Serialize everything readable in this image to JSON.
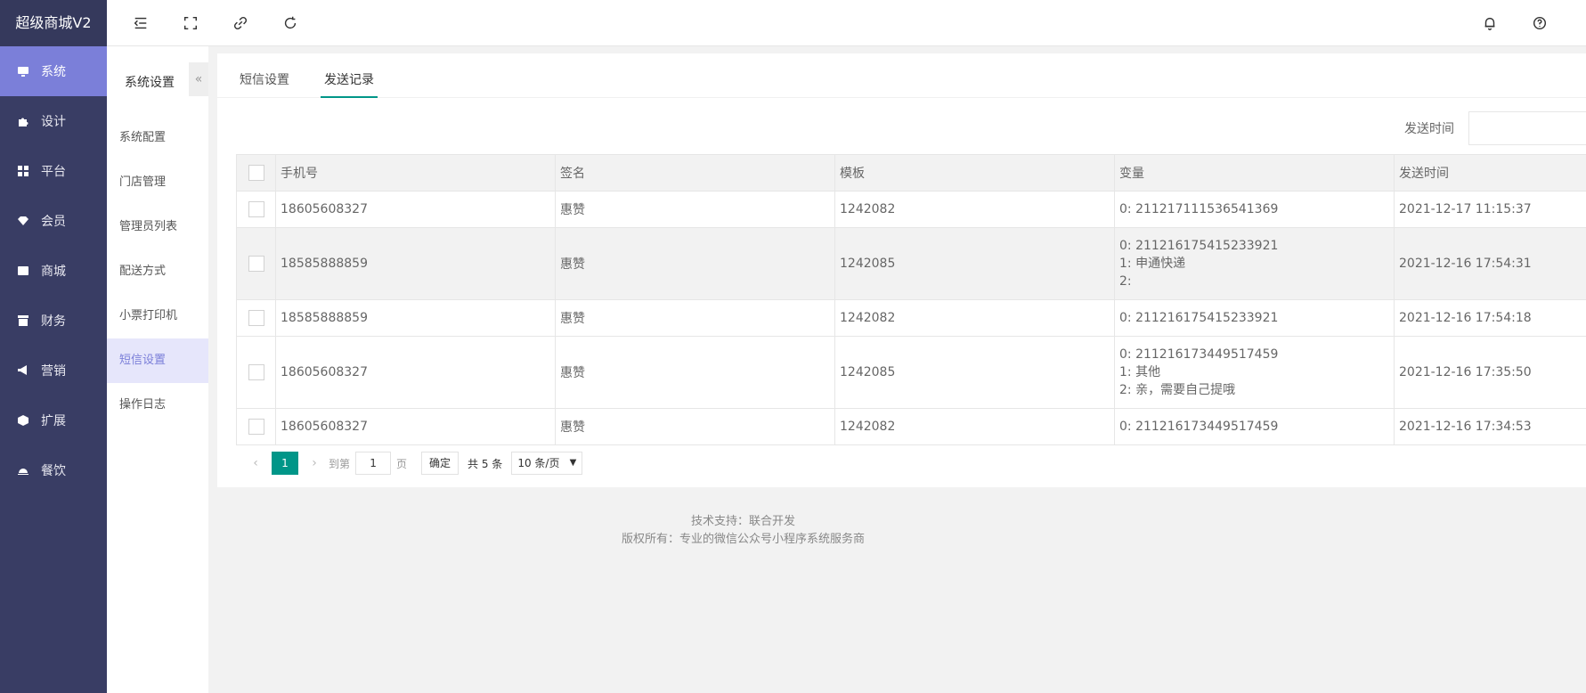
{
  "brand": "超级商城V2",
  "nav": [
    {
      "label": "系统",
      "icon": "monitor-icon",
      "active": true
    },
    {
      "label": "设计",
      "icon": "puzzle-icon",
      "active": false
    },
    {
      "label": "平台",
      "icon": "grid-icon",
      "active": false
    },
    {
      "label": "会员",
      "icon": "diamond-icon",
      "active": false
    },
    {
      "label": "商城",
      "icon": "mail-icon",
      "active": false
    },
    {
      "label": "财务",
      "icon": "archive-icon",
      "active": false
    },
    {
      "label": "营销",
      "icon": "megaphone-icon",
      "active": false
    },
    {
      "label": "扩展",
      "icon": "cube-icon",
      "active": false
    },
    {
      "label": "餐饮",
      "icon": "bell-tray-icon",
      "active": false
    }
  ],
  "subside": {
    "title": "系统设置",
    "collapse": "«",
    "items": [
      "系统配置",
      "门店管理",
      "管理员列表",
      "配送方式",
      "小票打印机",
      "短信设置",
      "操作日志"
    ],
    "active_index": 5
  },
  "tabs": [
    "短信设置",
    "发送记录"
  ],
  "filter": {
    "label": "发送时间",
    "value": ""
  },
  "table": {
    "headers": [
      "手机号",
      "签名",
      "模板",
      "变量",
      "发送时间"
    ],
    "rows": [
      {
        "phone": "18605608327",
        "sign": "惠赞",
        "template": "1242082",
        "vars": [
          "0: 211217111536541369"
        ],
        "time": "2021-12-17 11:15:37"
      },
      {
        "phone": "18585888859",
        "sign": "惠赞",
        "template": "1242085",
        "vars": [
          "0: 211216175415233921",
          "1: 申通快递",
          "2:"
        ],
        "time": "2021-12-16 17:54:31"
      },
      {
        "phone": "18585888859",
        "sign": "惠赞",
        "template": "1242082",
        "vars": [
          "0: 211216175415233921"
        ],
        "time": "2021-12-16 17:54:18"
      },
      {
        "phone": "18605608327",
        "sign": "惠赞",
        "template": "1242085",
        "vars": [
          "0: 211216173449517459",
          "1: 其他",
          "2: 亲，需要自己提哦"
        ],
        "time": "2021-12-16 17:35:50"
      },
      {
        "phone": "18605608327",
        "sign": "惠赞",
        "template": "1242082",
        "vars": [
          "0: 211216173449517459"
        ],
        "time": "2021-12-16 17:34:53"
      }
    ]
  },
  "pager": {
    "current": "1",
    "goto_label": "到第",
    "goto_value": "1",
    "page_label": "页",
    "confirm": "确定",
    "total": "共 5 条",
    "page_size": "10 条/页"
  },
  "footer": {
    "line1": "技术支持：联合开发",
    "line2": "版权所有：专业的微信公众号小程序系统服务商"
  },
  "colors": {
    "sidebar": "#393d64",
    "active_nav": "#7b7fd9",
    "accent": "#009688"
  }
}
